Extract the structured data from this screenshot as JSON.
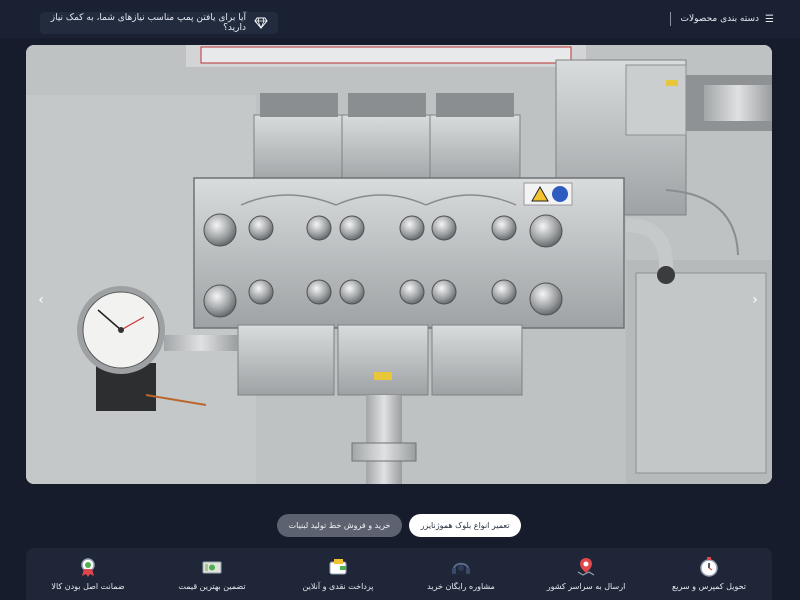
{
  "header": {
    "category_menu_label": "دسته بندی محصولات",
    "category_menu_icon": "menu-icon",
    "promo_text": "آیا برای یافتن پمپ مناسب نیازهای شما، به کمک نیاز دارید؟",
    "promo_icon": "diamond-icon"
  },
  "hero": {
    "image_subject": "stainless-steel-homogenizer-pump",
    "prev_icon": "chevron-left-icon",
    "next_icon": "chevron-right-icon",
    "prev_glyph": "‹",
    "next_glyph": "›"
  },
  "slider_tabs": [
    {
      "label": "تعمیر انواع بلوک هموژنایزر",
      "active": true
    },
    {
      "label": "خرید و فروش خط تولید لبنیات",
      "active": false
    }
  ],
  "features": [
    {
      "label": "تحویل کمپرس و سریع",
      "icon": "stopwatch-icon"
    },
    {
      "label": "ارسال به سراسر کشور",
      "icon": "map-pin-icon"
    },
    {
      "label": "مشاوره رایگان خرید",
      "icon": "headset-icon"
    },
    {
      "label": "پرداخت نقدی و آنلاین",
      "icon": "wallet-icon"
    },
    {
      "label": "تضمین بهترین قیمت",
      "icon": "cash-icon"
    },
    {
      "label": "ضمانت اصل بودن کالا",
      "icon": "badge-icon"
    }
  ],
  "colors": {
    "page_bg": "#161c2c",
    "bar_bg": "#1a2133",
    "accent_red": "#e0474c",
    "accent_yellow": "#f2c230"
  }
}
